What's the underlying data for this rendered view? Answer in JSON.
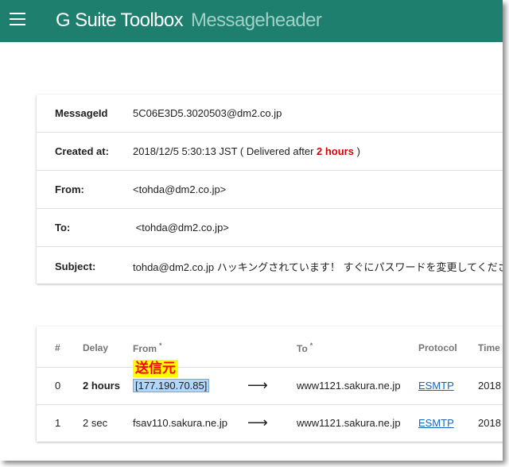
{
  "app": {
    "title": "G Suite Toolbox",
    "subtitle": "Messageheader"
  },
  "summary": {
    "rows": [
      {
        "label": "MessageId",
        "value": "5C06E3D5.3020503@dm2.co.jp"
      },
      {
        "label": "Created at:",
        "value": "2018/12/5 5:30:13 JST ( Delivered after ",
        "delay": "2 hours",
        "suffix": " )"
      },
      {
        "label": "From:",
        "value": "<tohda@dm2.co.jp>"
      },
      {
        "label": "To:",
        "value": " <tohda@dm2.co.jp>"
      },
      {
        "label": "Subject:",
        "value": "tohda@dm2.co.jp ハッキングされています！ すぐにパスワードを変更してくださ"
      }
    ]
  },
  "hops": {
    "headers": {
      "num": "#",
      "delay": "Delay",
      "from": "From",
      "to": "To",
      "protocol": "Protocol",
      "time": "Time"
    },
    "star": "*",
    "arrow": "⟶",
    "rows": [
      {
        "num": "0",
        "delay": "2 hours",
        "from": "[177.190.70.85]",
        "to": "www1121.sakura.ne.jp",
        "protocol": "ESMTP",
        "time": "2018"
      },
      {
        "num": "1",
        "delay": "2 sec",
        "from": "fsav110.sakura.ne.jp",
        "to": "www1121.sakura.ne.jp",
        "protocol": "ESMTP",
        "time": "2018"
      }
    ]
  },
  "annotation": {
    "text": "送信元"
  },
  "colors": {
    "topbar": "#1e7f6e",
    "delay_red": "#c62828",
    "delay_green": "#2e7d32",
    "link": "#1565c0",
    "annotation_bg": "#ffff00",
    "annotation_text": "#ff0000"
  },
  "icons": {
    "menu": "hamburger-menu-icon"
  }
}
